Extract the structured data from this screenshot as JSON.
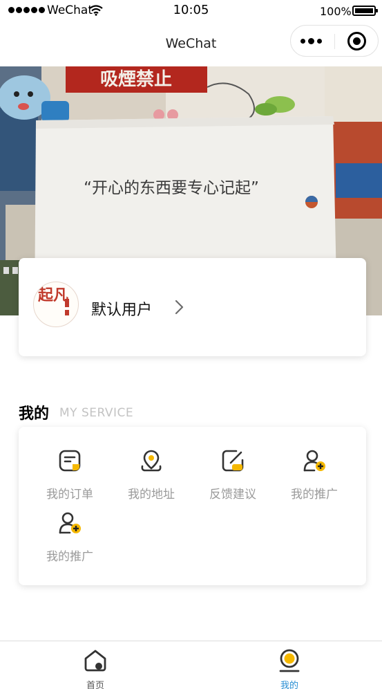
{
  "status_bar": {
    "carrier": "WeChat",
    "time": "10:05",
    "battery": "100%"
  },
  "nav": {
    "title": "WeChat"
  },
  "banner": {
    "quote": "“开心的东西要专心记起”",
    "sign_text": "吸煙禁止"
  },
  "user": {
    "avatar_text": "起凡",
    "name": "默认用户"
  },
  "section": {
    "title": "我的",
    "subtitle": "MY SERVICE"
  },
  "services": [
    {
      "label": "我的订单",
      "icon": "order-icon"
    },
    {
      "label": "我的地址",
      "icon": "location-icon"
    },
    {
      "label": "反馈建议",
      "icon": "feedback-icon"
    },
    {
      "label": "我的推广",
      "icon": "add-user-icon"
    },
    {
      "label": "我的推广",
      "icon": "add-user-icon"
    }
  ],
  "tabs": [
    {
      "label": "首页",
      "icon": "home-icon",
      "active": false
    },
    {
      "label": "我的",
      "icon": "profile-icon",
      "active": true
    }
  ],
  "colors": {
    "accent_yellow": "#f5b800",
    "tab_active": "#2a8fd4",
    "icon_dark": "#333333",
    "label_gray": "#9a9a9a"
  }
}
